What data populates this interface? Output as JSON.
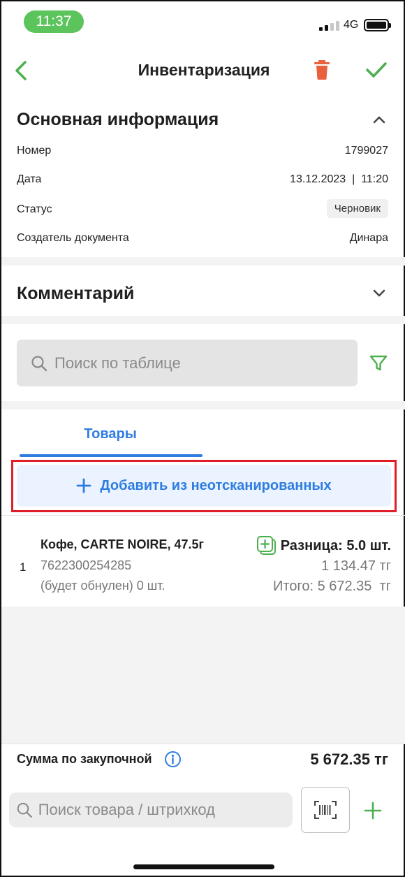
{
  "status_bar": {
    "time": "11:37",
    "network": "4G"
  },
  "header": {
    "title": "Инвентаризация",
    "back_icon": "chevron-left-icon",
    "delete_icon": "trash-icon",
    "confirm_icon": "checkmark-icon"
  },
  "main_info": {
    "title": "Основная информация",
    "rows": [
      {
        "label": "Номер",
        "value": "1799027"
      },
      {
        "label": "Дата",
        "value": "13.12.2023  |  11:20"
      },
      {
        "label": "Статус",
        "value": "Черновик"
      },
      {
        "label": "Создатель документа",
        "value": "Динара"
      }
    ]
  },
  "comment": {
    "title": "Комментарий"
  },
  "table_search": {
    "placeholder": "Поиск по таблице"
  },
  "tabs": [
    {
      "label": "Товары",
      "active": true
    }
  ],
  "add_button": {
    "label": "Добавить из неотсканированных"
  },
  "items": [
    {
      "index": "1",
      "name": "Кофе, CARTE NOIRE, 47.5г",
      "barcode": "7622300254285",
      "note": "(будет обнулен) 0 шт.",
      "difference": "Разница: 5.0 шт.",
      "price": "1 134.47 тг",
      "total": "Итого: 5 672.35  тг"
    }
  ],
  "footer": {
    "sum_label": "Сумма по закупочной",
    "sum_value": "5 672.35 тг",
    "search_placeholder": "Поиск товара / штрихкод"
  },
  "colors": {
    "green": "#4caf50",
    "red": "#e8603c",
    "blue": "#2f7de1",
    "highlight": "#e01e2a"
  }
}
